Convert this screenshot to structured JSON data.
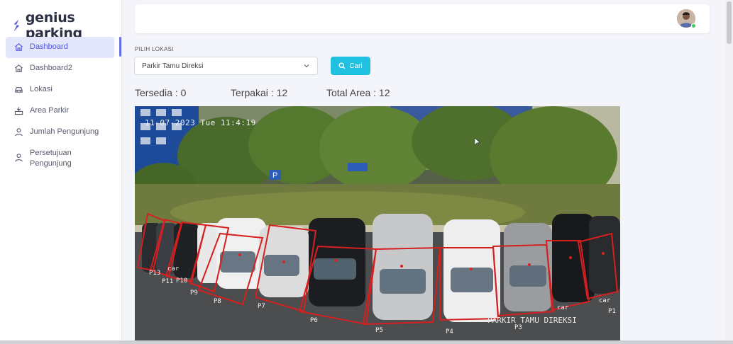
{
  "brand": {
    "name": "genius parking",
    "color": "#5b5fe0"
  },
  "sidebar": {
    "items": [
      {
        "label": "Dashboard",
        "icon": "home-icon",
        "active": true
      },
      {
        "label": "Dashboard2",
        "icon": "home-icon"
      },
      {
        "label": "Lokasi",
        "icon": "car-icon"
      },
      {
        "label": "Area Parkir",
        "icon": "parking-area-icon"
      },
      {
        "label": "Jumlah Pengunjung",
        "icon": "user-icon"
      },
      {
        "label": "Persetujuan Pengunjung",
        "icon": "user-icon"
      }
    ]
  },
  "filter": {
    "location_label": "PILIH LOKASI",
    "selected_location": "Parkir Tamu Direksi",
    "search_label": "Cari"
  },
  "stats": {
    "available": "Tersedia : 0",
    "used": "Terpakai : 12",
    "total": "Total Area : 12"
  },
  "camera": {
    "timestamp": "11-07-2023 Tue 11:4:19",
    "location_overlay": "PARKIR TAMU DIREKSI",
    "slots": [
      "P13",
      "P11",
      "P10",
      "P9",
      "P8",
      "P7",
      "P6",
      "P5",
      "P4",
      "P3",
      "P1",
      "car",
      "car",
      "car"
    ]
  },
  "colors": {
    "accent": "#4b55d9",
    "active_bg": "#e4e6fb",
    "search_button": "#1fc0e0",
    "slot_outline": "#d61f1f"
  }
}
